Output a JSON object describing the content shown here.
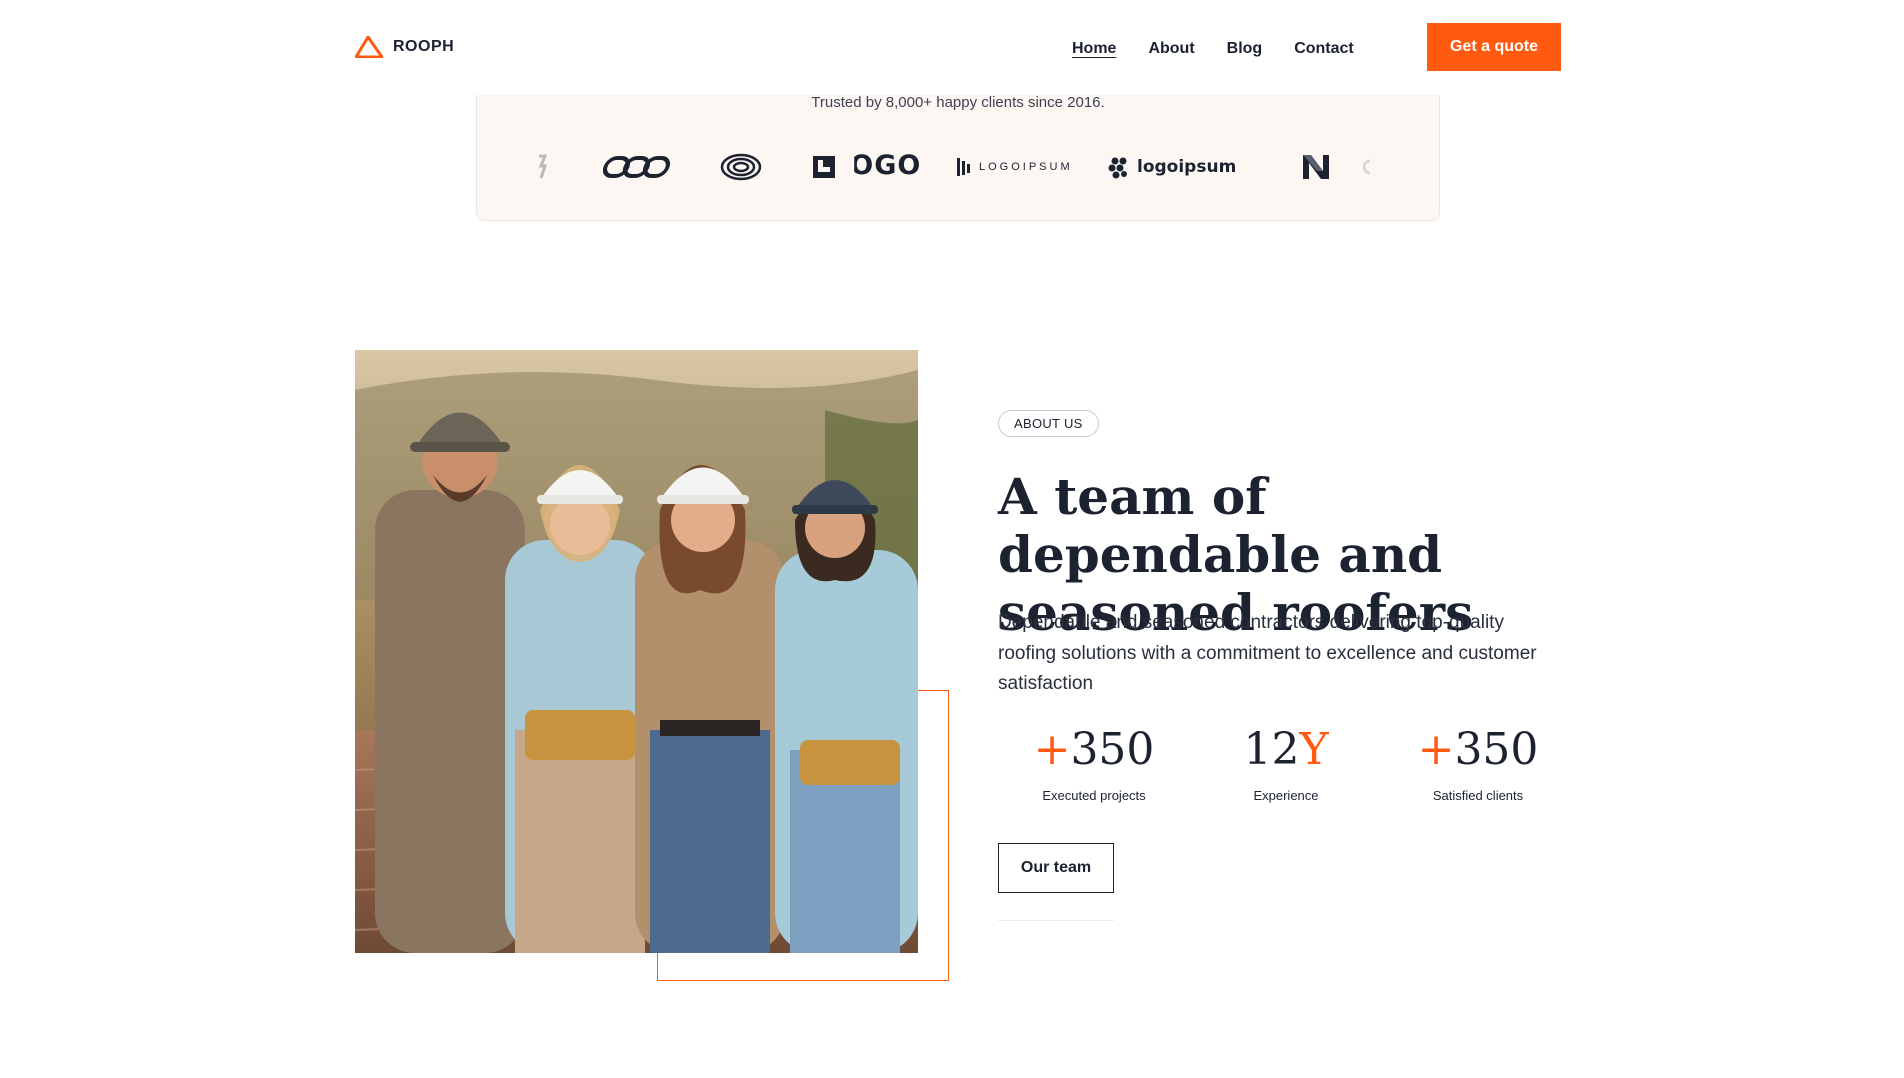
{
  "header": {
    "brand": "ROOPH",
    "nav": [
      {
        "label": "Home",
        "active": true
      },
      {
        "label": "About",
        "active": false
      },
      {
        "label": "Blog",
        "active": false
      },
      {
        "label": "Contact",
        "active": false
      }
    ],
    "cta": "Get a quote"
  },
  "trusted": {
    "text": "Trusted by 8,000+ happy clients since 2016.",
    "logos": [
      "LOGO",
      "LOGOIPSUM",
      "logoipsum"
    ]
  },
  "about": {
    "tag": "ABOUT US",
    "headline": "A team of dependable and seasoned roofers",
    "description": "Dependable and seasoned contractors delivering top-quality roofing solutions with a commitment to excellence and customer satisfaction",
    "stats": [
      {
        "prefix": "+",
        "number": "350",
        "suffix": "",
        "label": "Executed projects"
      },
      {
        "prefix": "",
        "number": "12",
        "suffix": "Y",
        "label": "Experience"
      },
      {
        "prefix": "+",
        "number": "350",
        "suffix": "",
        "label": "Satisfied clients"
      }
    ],
    "button": "Our team"
  },
  "colors": {
    "accent": "#ff5a0f",
    "text": "#1c2230",
    "strip_bg": "#fdf7f4"
  }
}
